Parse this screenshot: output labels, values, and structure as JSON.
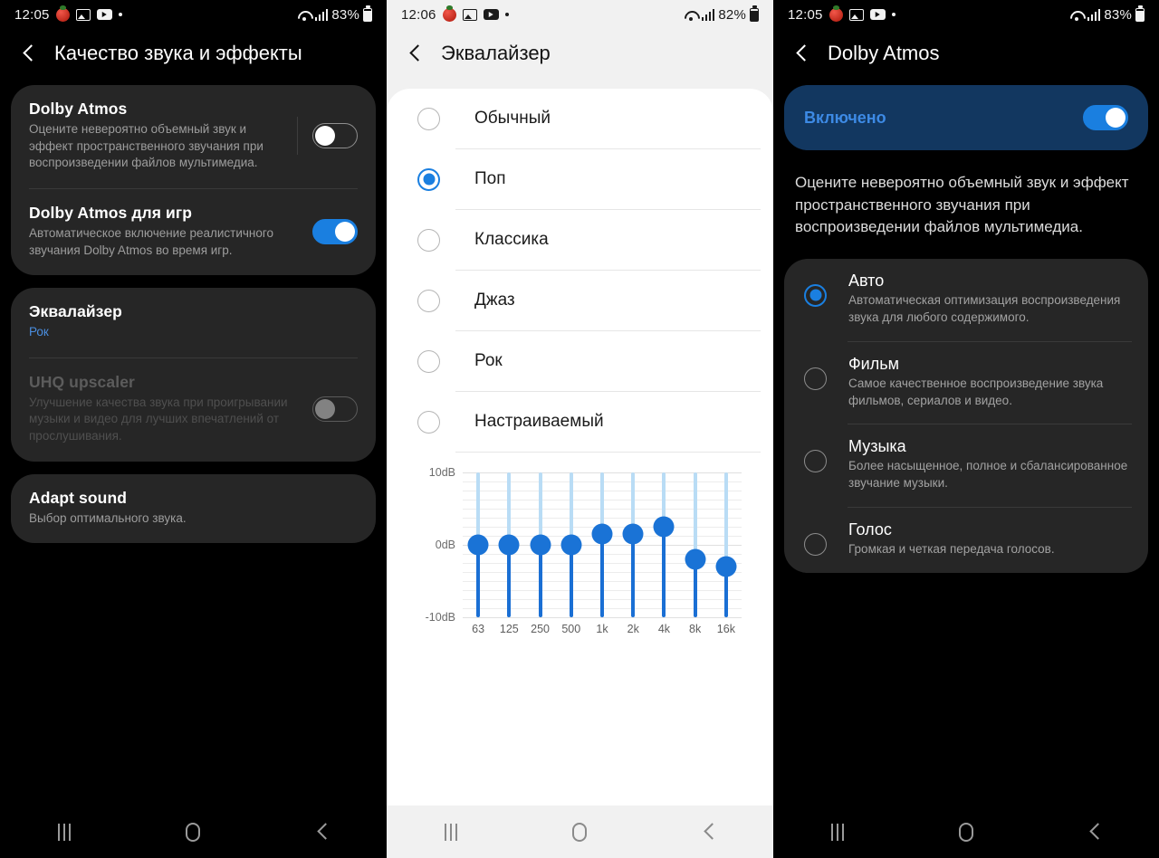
{
  "panels": {
    "sound_quality": {
      "statusbar": {
        "time": "12:05",
        "battery": "83%",
        "icons": [
          "tomato-icon",
          "gallery-icon",
          "youtube-icon",
          "dot-icon"
        ],
        "right_icons": [
          "wifi-icon",
          "signal-icon",
          "battery-icon"
        ]
      },
      "title": "Качество звука и эффекты",
      "back_icon": "back-chevron-icon",
      "items": [
        {
          "name": "dolby-atmos",
          "title": "Dolby Atmos",
          "subtitle": "Оцените невероятно объемный звук и эффект пространственного звучания при воспроизведении файлов мультимедиа.",
          "toggle": "off",
          "has_separator": true,
          "disabled": false
        },
        {
          "name": "dolby-atmos-games",
          "title": "Dolby Atmos для игр",
          "subtitle": "Автоматическое включение реалистичного звучания Dolby Atmos во время игр.",
          "toggle": "on",
          "has_separator": false,
          "disabled": false
        },
        {
          "name": "equalizer",
          "title": "Эквалайзер",
          "subtitle": "Рок",
          "subtitle_is_link": true,
          "toggle": "none",
          "disabled": false
        },
        {
          "name": "uhq-upscaler",
          "title": "UHQ upscaler",
          "subtitle": "Улучшение качества звука при проигрывании музыки и видео для лучших впечатлений от прослушивания.",
          "toggle": "off-dim",
          "disabled": true
        },
        {
          "name": "adapt-sound",
          "title": "Adapt sound",
          "subtitle": "Выбор оптимального звука.",
          "toggle": "none",
          "disabled": false
        }
      ]
    },
    "equalizer": {
      "statusbar": {
        "time": "12:06",
        "battery": "82%"
      },
      "title": "Эквалайзер",
      "back_icon": "back-chevron-icon",
      "presets": [
        {
          "label": "Обычный",
          "selected": false
        },
        {
          "label": "Поп",
          "selected": true
        },
        {
          "label": "Классика",
          "selected": false
        },
        {
          "label": "Джаз",
          "selected": false
        },
        {
          "label": "Рок",
          "selected": false
        },
        {
          "label": "Настраиваемый",
          "selected": false
        }
      ]
    },
    "dolby_atmos": {
      "statusbar": {
        "time": "12:05",
        "battery": "83%"
      },
      "title": "Dolby Atmos",
      "back_icon": "back-chevron-icon",
      "banner": {
        "label": "Включено",
        "toggle": "on"
      },
      "description": "Оцените невероятно объемный звук и эффект пространственного звучания при воспроизведении файлов мультимедиа.",
      "options": [
        {
          "title": "Авто",
          "subtitle": "Автоматическая оптимизация воспроизведения звука для любого содержимого.",
          "selected": true
        },
        {
          "title": "Фильм",
          "subtitle": "Самое качественное воспроизведение звука фильмов, сериалов и видео.",
          "selected": false
        },
        {
          "title": "Музыка",
          "subtitle": "Более насыщенное, полное и сбалансированное звучание музыки.",
          "selected": false
        },
        {
          "title": "Голос",
          "subtitle": "Громкая и четкая передача голосов.",
          "selected": false
        }
      ]
    }
  },
  "navbar": {
    "recents_label": "recents-icon",
    "home_label": "home-icon",
    "back_label": "back-icon"
  },
  "colors": {
    "accent_blue": "#1a7fe0",
    "card_dark": "#262626",
    "banner_navy": "#123760",
    "banner_text": "#3d8ae5",
    "bar_blue": "#1a6fd4",
    "bar_track": "#b9dcf5"
  },
  "chart_data": {
    "type": "bar",
    "title": "",
    "xlabel": "",
    "ylabel": "dB",
    "categories": [
      "63",
      "125",
      "250",
      "500",
      "1k",
      "2k",
      "4k",
      "8k",
      "16k"
    ],
    "values": [
      0,
      0,
      0,
      0,
      1.5,
      1.5,
      2.5,
      -2,
      -3
    ],
    "ylim": [
      -10,
      10
    ],
    "ytick_labels": [
      "10dB",
      "0dB",
      "-10dB"
    ],
    "yticks": [
      10,
      0,
      -10
    ],
    "gridlines": [
      10,
      8.75,
      7.5,
      6.25,
      5,
      3.75,
      2.5,
      1.25,
      0,
      -1.25,
      -2.5,
      -3.75,
      -5,
      -6.25,
      -7.5,
      -8.75,
      -10
    ],
    "grid": true,
    "legend": "none"
  }
}
